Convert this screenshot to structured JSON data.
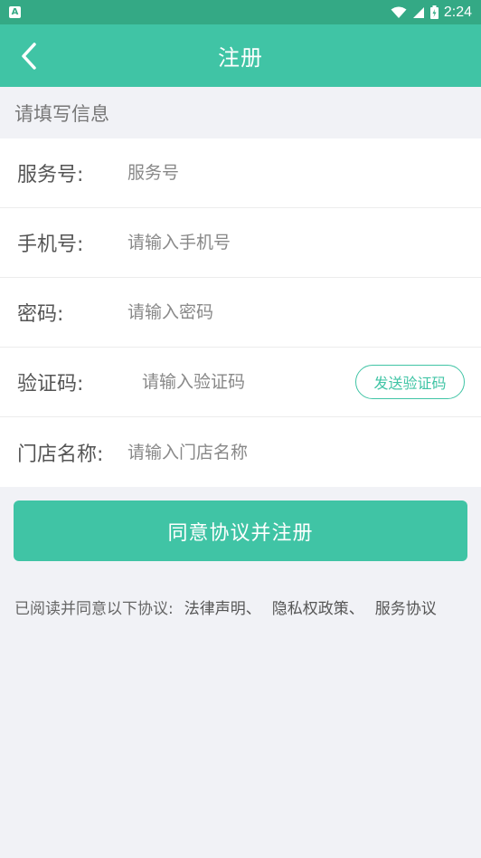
{
  "status_bar": {
    "app_icon_letter": "A",
    "time": "2:24",
    "icons": [
      "wifi-icon",
      "signal-icon",
      "battery-icon"
    ]
  },
  "app_bar": {
    "title": "注册",
    "back_icon": "chevron-left-icon"
  },
  "section_title": "请填写信息",
  "form": {
    "service_no": {
      "label": "服务号:",
      "placeholder": "服务号"
    },
    "phone": {
      "label": "手机号:",
      "placeholder": "请输入手机号"
    },
    "password": {
      "label": "密码:",
      "placeholder": "请输入密码"
    },
    "code": {
      "label": "验证码:",
      "placeholder": "请输入验证码",
      "send_label": "发送验证码"
    },
    "store_name": {
      "label": "门店名称:",
      "placeholder": "请输入门店名称"
    }
  },
  "submit_label": "同意协议并注册",
  "agreement": {
    "prefix": "已阅读并同意以下协议:",
    "links": [
      "法律声明、",
      "隐私权政策、",
      "服务协议"
    ]
  },
  "colors": {
    "status_bar": "#34a985",
    "primary": "#40c4a5",
    "background": "#f1f2f6"
  }
}
